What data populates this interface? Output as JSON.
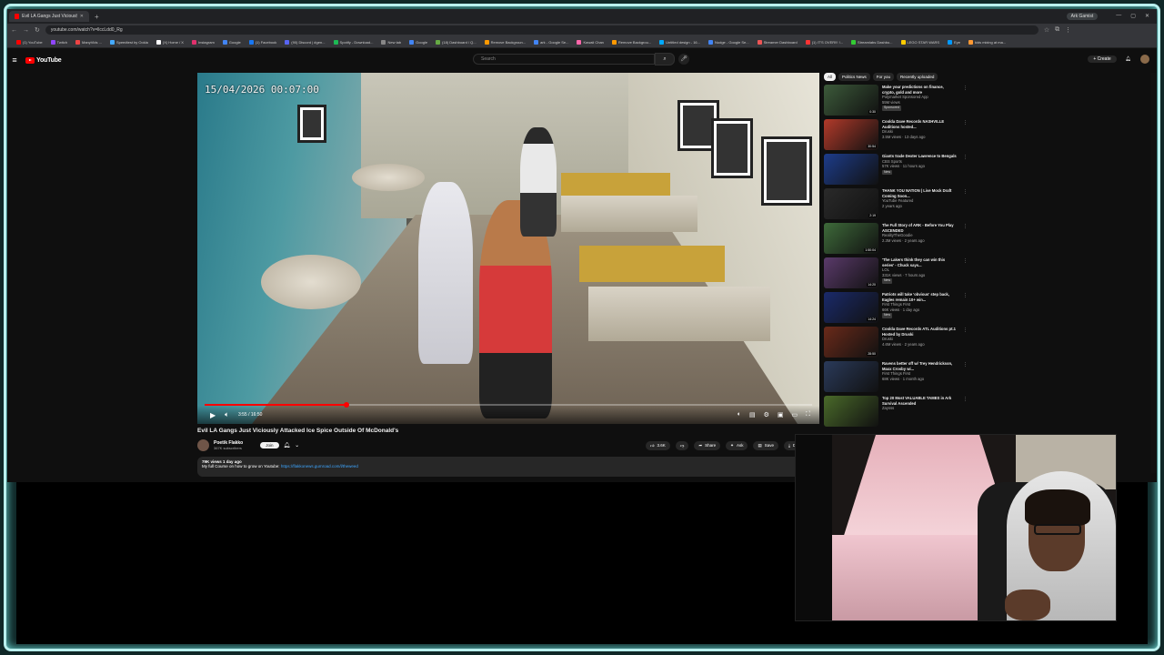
{
  "browser": {
    "tab_title": "Evil LA Gangs Just Viciously Att",
    "url": "youtube.com/watch?v=llccLdd0_Rg",
    "account_chip": "Ark Gamist",
    "bookmarks": [
      "(1) YouTube",
      "Twitch",
      "ManyVids ...",
      "Speedtest by Ookla",
      "(X) Home / X",
      "Instagram",
      "Google",
      "(1) Facebook",
      "(90) Discord | #gen...",
      "Spotify - Download...",
      "New tab",
      "Google",
      "(18) Dashboard / Q...",
      "Remove Backgroun...",
      "ark - Google Se...",
      "Kawaii Chan",
      "Remove Backgrou...",
      "Untitled design - 16...",
      "Nudge - Google Se...",
      "Streamer Dashboard",
      "(1) IT'S OVER!!! !...",
      "Streamlabs Dashbo...",
      "LEGO STAR WARS",
      "Eye",
      "kids mixing at ma..."
    ]
  },
  "youtube": {
    "logo_text": "YouTube",
    "search_placeholder": "Search",
    "create_label": "Create"
  },
  "video": {
    "timestamp_overlay": "15/04/2026 00:07:00",
    "time_display": "3:55 / 16:50",
    "progress": 0.233,
    "title": "Evil LA Gangs Just Viciously Attacked Ice Spice Outside Of McDonald's",
    "channel_name": "Poetik Flakko",
    "subscribers": "367K subscribers",
    "join_label": "Join",
    "actions": {
      "like_count": "3.6K",
      "share": "Share",
      "ask": "Ask",
      "save": "Save",
      "download": "Download"
    },
    "description": {
      "views_age": "79K views  1 day ago",
      "text": "My full Course on how to grow on Youtube: ",
      "link": "https://flakkonews.gumroad.com/l/theweed"
    }
  },
  "sidebar": {
    "chips": [
      "All",
      "Politics News",
      "For you",
      "Recently uploaded"
    ],
    "items": [
      {
        "title": "Make your predictions on finance, crypto, gold and more",
        "channel": "Polymarket Sponsored App",
        "meta": "55M views",
        "badge": "Sponsored",
        "duration": "0:30",
        "color": "#3c5a3a"
      },
      {
        "title": "Coolda Dave Records NASHVILLE Auditions hosted...",
        "channel": "Druski",
        "meta": "3.5M views · 13 days ago",
        "badge": "",
        "duration": "30:54",
        "color": "#b23a2a"
      },
      {
        "title": "Giants trade Dexter Lawrence to Bengals",
        "channel": "CBS Sports",
        "meta": "57K views · 11 hours ago",
        "badge": "New",
        "duration": "",
        "color": "#1d3c8a"
      },
      {
        "title": "THANK YOU NATION | Live Mock Draft Coming Soon...",
        "channel": "YouTube Featured",
        "meta": "2 years ago",
        "badge": "",
        "duration": "2:19",
        "color": "#2a2a2a"
      },
      {
        "title": "The Full Story of ARK - Before You Play ASCENDED",
        "channel": "RealityTheGoodie",
        "meta": "2.3M views · 2 years ago",
        "badge": "",
        "duration": "1:50:04",
        "color": "#3e6a3a"
      },
      {
        "title": "'The Lakers think they can win this series' - Chuck says...",
        "channel": "LOL",
        "meta": "331K views · 7 hours ago",
        "badge": "New",
        "duration": "14:20",
        "color": "#5a3a6a"
      },
      {
        "title": "Patriots will take 'obvious' step back, Eagles remain 10+ win...",
        "channel": "First Things First",
        "meta": "66K views · 1 day ago",
        "badge": "New",
        "duration": "14:24",
        "color": "#1a2a6a"
      },
      {
        "title": "Coolda Dave Records ATL Auditions pt.1 Hosted by Druski",
        "channel": "Druski",
        "meta": "4.6M views · 2 years ago",
        "badge": "",
        "duration": "28:50",
        "color": "#6a2a1a"
      },
      {
        "title": "Ravens better off w/ Trey Hendrickson, Maxx Crosby wi...",
        "channel": "First Things First",
        "meta": "68K views · 1 month ago",
        "badge": "",
        "duration": "",
        "color": "#2a3a5a"
      },
      {
        "title": "Top 20 Most VALUABLE TAMES in Ark Survival Ascended",
        "channel": "Zaysss",
        "meta": "",
        "badge": "",
        "duration": "",
        "color": "#4a6a2a"
      }
    ]
  }
}
